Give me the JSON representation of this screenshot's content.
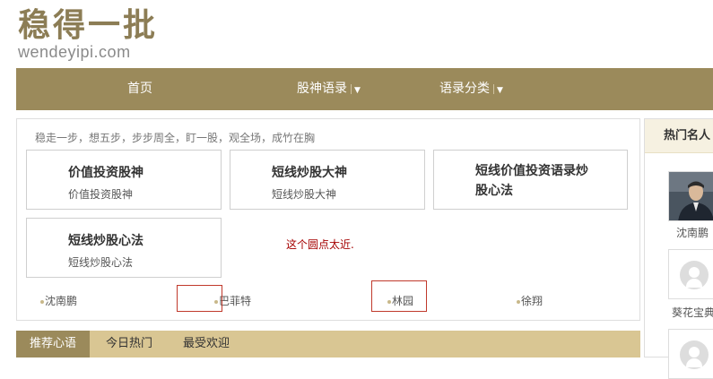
{
  "brand": {
    "logo_text": "稳得一批",
    "domain": "wendeyipi.com"
  },
  "nav": {
    "items": [
      {
        "label": "首页",
        "has_dropdown": false
      },
      {
        "label": "股神语录",
        "has_dropdown": true
      },
      {
        "label": "语录分类",
        "has_dropdown": true
      }
    ],
    "caret": "▼"
  },
  "main": {
    "motto": "稳走一步，想五步，步步周全，盯一股，观全场，成竹在胸",
    "cards": [
      {
        "title": "价值投资股神",
        "subtitle": "价值投资股神"
      },
      {
        "title": "短线炒股大神",
        "subtitle": "短线炒股大神"
      },
      {
        "title": "短线价值投资语录炒股心法",
        "subtitle": ""
      },
      {
        "title": "短线炒股心法",
        "subtitle": "短线炒股心法"
      }
    ],
    "annotation": "这个圆点太近.",
    "names": [
      "沈南鹏",
      "巴菲特",
      "林园",
      "徐翔"
    ]
  },
  "tabs": [
    "推荐心语",
    "今日热门",
    "最受欢迎"
  ],
  "sidebar": {
    "title": "热门名人",
    "people": [
      {
        "name": "沈南鹏",
        "avatar": "photo"
      },
      {
        "name": "葵花宝典",
        "avatar": "placeholder"
      },
      {
        "name": "",
        "avatar": "placeholder"
      }
    ]
  },
  "colors": {
    "nav_bg": "#9b8a5b",
    "tab_bar_bg": "#d9c693",
    "logo": "#8c7d55",
    "annotation": "#a50000"
  }
}
